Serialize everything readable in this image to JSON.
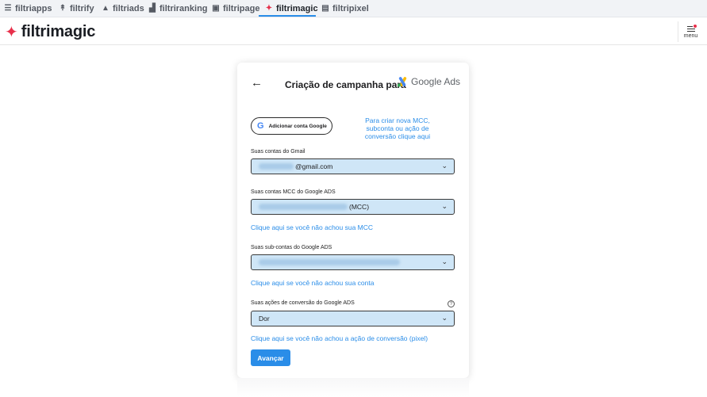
{
  "topnav": {
    "items": [
      {
        "label": "filtriapps",
        "icon": "stack-icon"
      },
      {
        "label": "filtrify",
        "icon": "filter-icon"
      },
      {
        "label": "filtriads",
        "icon": "triangle-icon"
      },
      {
        "label": "filtriranking",
        "icon": "ranking-icon"
      },
      {
        "label": "filtripage",
        "icon": "page-icon"
      },
      {
        "label": "filtrimagic",
        "icon": "sparkle-icon",
        "active": true
      },
      {
        "label": "filtripixel",
        "icon": "grid-icon"
      }
    ]
  },
  "header": {
    "logo_text": "filtrimagic",
    "menu_label": "menu"
  },
  "card": {
    "title": "Criação de campanha para",
    "brand_text": "Google Ads",
    "google_button_label": "Adicionar conta Google",
    "mcc_help_link": "Para criar nova MCC, subconta ou ação de conversão clique aqui",
    "gmail": {
      "label": "Suas contas do Gmail",
      "value": "@gmail.com"
    },
    "mcc": {
      "label": "Suas contas MCC do Google ADS",
      "value": "(MCC)",
      "link": "Clique aqui se você não achou sua MCC"
    },
    "subaccount": {
      "label": "Suas sub-contas do Google ADS",
      "link": "Clique aqui se você não achou sua conta"
    },
    "conversion": {
      "label": "Suas ações de conversão do Google ADS",
      "value": "Dor",
      "link": "Clique aqui se você não achou a ação de conversão (pixel)"
    },
    "submit_label": "Avançar"
  },
  "colors": {
    "accent": "#2a8de8",
    "brand_red": "#e8304b",
    "select_bg": "#cfe6f7"
  }
}
